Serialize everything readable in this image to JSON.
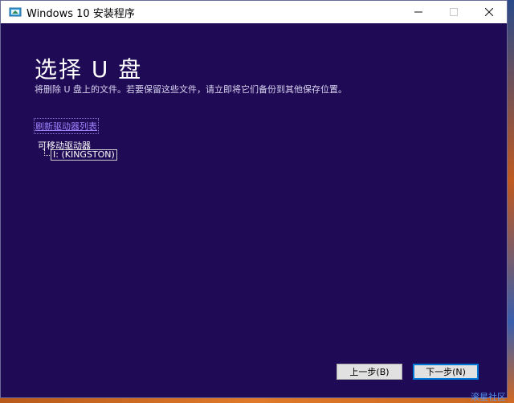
{
  "window": {
    "title": "Windows 10 安装程序",
    "icons": {
      "app": "windows-setup-icon",
      "minimize": "minimize-icon",
      "maximize": "maximize-icon",
      "close": "close-icon"
    }
  },
  "page": {
    "heading": "选择 U 盘",
    "subtitle": "将删除 U 盘上的文件。若要保留这些文件，请立即将它们备份到其他保存位置。",
    "refresh_link": "刷新驱动器列表",
    "tree": {
      "root_label": "可移动驱动器",
      "items": [
        {
          "label": "I: (KINGSTON)",
          "selected": true
        }
      ]
    }
  },
  "buttons": {
    "back_label": "上一步(B)",
    "next_label": "下一步(N)"
  },
  "watermark": "滚星社区",
  "colors": {
    "window_bg": "#1f0a55",
    "link": "#9d86ff",
    "accent": "#0078d7"
  }
}
